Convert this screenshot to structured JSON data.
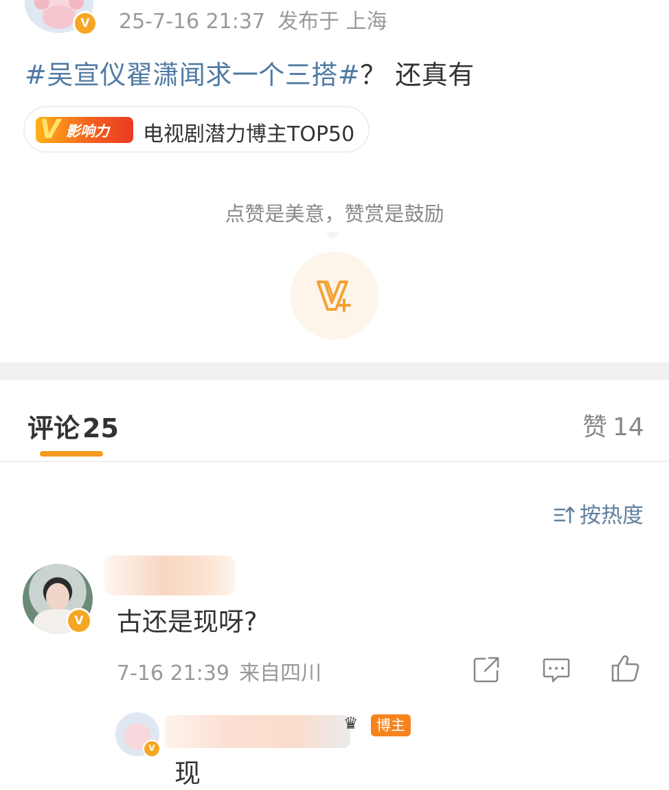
{
  "post": {
    "datetime": "25-7-16 21:37",
    "location": "发布于 上海",
    "topic": "#吴宣仪翟潇闻求一个三搭#",
    "text_after_topic": "？ 还真有",
    "influence_badge_text": "影响力",
    "influence_text": "电视剧潜力博主TOP50",
    "verified_badge": "V"
  },
  "reward": {
    "caption": "点赞是美意，赞赏是鼓励",
    "icon": "reward-v-plus-icon"
  },
  "tabs": {
    "comments_label": "评论",
    "comments_count": "25",
    "likes_label": "赞",
    "likes_count": "14",
    "active": "comments"
  },
  "sort": {
    "label": "按热度",
    "icon": "sort-icon"
  },
  "comment": {
    "text": "古还是现呀?",
    "datetime": "7-16 21:39",
    "location": "来自四川",
    "verified_badge": "V",
    "actions": [
      "share-icon",
      "reply-icon",
      "like-icon"
    ]
  },
  "reply": {
    "author_badge": "博主",
    "text": "现",
    "verified_badge": "V"
  },
  "colors": {
    "topic_link": "#4f7aa3",
    "accent_orange": "#f39a1f",
    "verified": "#f6a623",
    "muted_text": "#999999",
    "section_gap": "#f1f1f1"
  }
}
